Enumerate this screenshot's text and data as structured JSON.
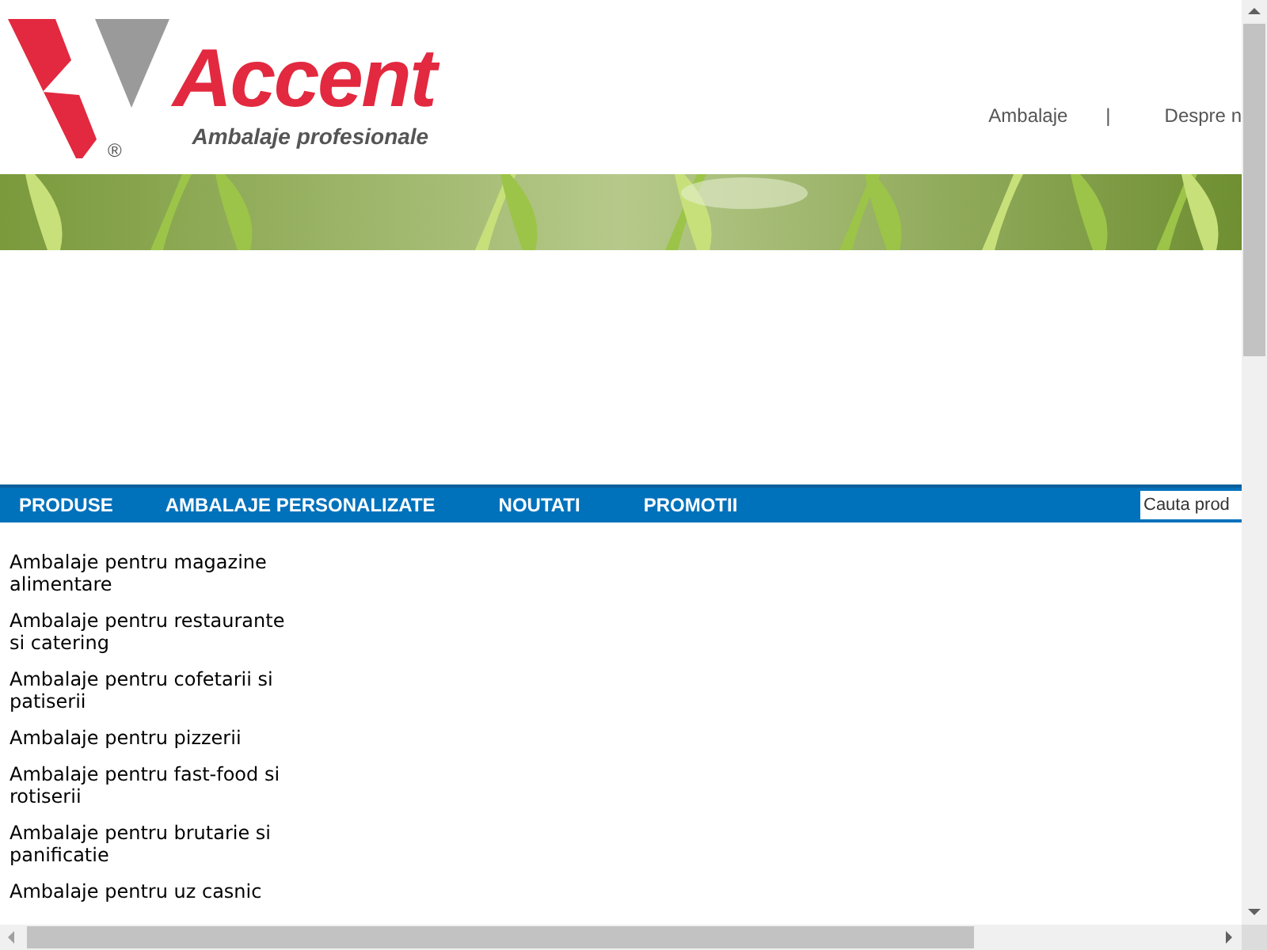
{
  "logo": {
    "name": "Accent",
    "tagline": "Ambalaje profesionale",
    "mark": "®"
  },
  "top_links": [
    {
      "label": "Ambalaje",
      "kind": "link"
    },
    {
      "label": "|",
      "kind": "separator"
    },
    {
      "label": "Despre n",
      "kind": "link"
    }
  ],
  "nav": {
    "items": [
      {
        "label": "PRODUSE"
      },
      {
        "label": "AMBALAJE PERSONALIZATE"
      },
      {
        "label": "NOUTATI"
      },
      {
        "label": "PROMOTII"
      }
    ],
    "search": {
      "placeholder": "Cauta prod"
    }
  },
  "sidebar": {
    "items": [
      {
        "label": "Ambalaje pentru magazine alimentare"
      },
      {
        "label": "Ambalaje pentru restaurante si catering"
      },
      {
        "label": "Ambalaje pentru cofetarii si patiserii"
      },
      {
        "label": "Ambalaje pentru pizzerii"
      },
      {
        "label": "Ambalaje pentru fast-food si rotiserii"
      },
      {
        "label": "Ambalaje pentru brutarie si panificatie"
      },
      {
        "label": "Ambalaje pentru uz casnic"
      }
    ]
  }
}
